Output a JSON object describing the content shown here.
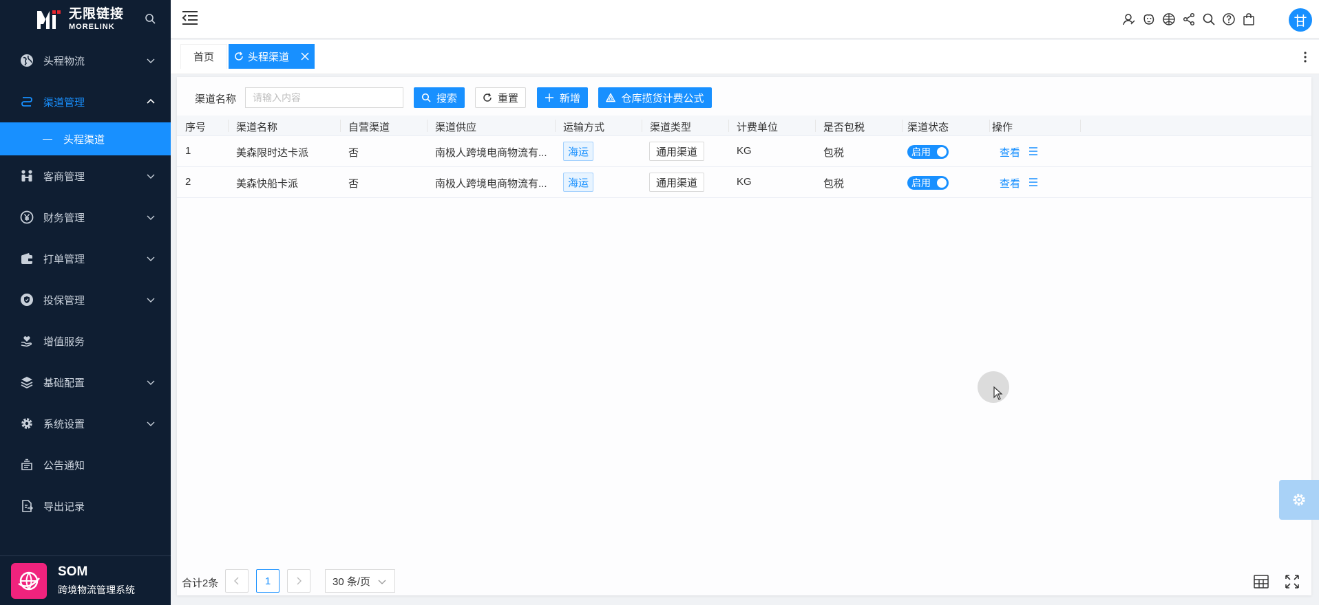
{
  "app": {
    "logo_cn": "无限链接",
    "logo_en": "MORELINK",
    "footer_title": "SOM",
    "footer_subtitle": "跨境物流管理系统"
  },
  "sidebar": {
    "items": [
      {
        "label": "头程物流",
        "icon": "globe-icon",
        "expandable": true
      },
      {
        "label": "渠道管理",
        "icon": "route-icon",
        "expandable": true,
        "expanded": true
      },
      {
        "label": "客商管理",
        "icon": "people-icon",
        "expandable": true
      },
      {
        "label": "财务管理",
        "icon": "yen-icon",
        "expandable": true
      },
      {
        "label": "打单管理",
        "icon": "wallet-icon",
        "expandable": true
      },
      {
        "label": "投保管理",
        "icon": "shield-icon",
        "expandable": true
      },
      {
        "label": "增值服务",
        "icon": "heart-hand-icon",
        "expandable": false
      },
      {
        "label": "基础配置",
        "icon": "layers-icon",
        "expandable": true
      },
      {
        "label": "系统设置",
        "icon": "gear-icon",
        "expandable": true
      },
      {
        "label": "公告通知",
        "icon": "announcement-icon",
        "expandable": false
      },
      {
        "label": "导出记录",
        "icon": "export-icon",
        "expandable": false
      }
    ],
    "submenu_active": "头程渠道"
  },
  "header": {
    "avatar_text": "甘",
    "tools": [
      "user-icon",
      "face-icon",
      "globe-grid-icon",
      "share-icon",
      "search-icon",
      "help-icon",
      "bag-icon"
    ]
  },
  "tabs": {
    "home": "首页",
    "active": "头程渠道"
  },
  "filter": {
    "label": "渠道名称",
    "placeholder": "请输入内容",
    "search_btn": "搜索",
    "reset_btn": "重置",
    "add_btn": "新增",
    "formula_btn": "仓库揽货计费公式"
  },
  "table": {
    "columns": [
      "序号",
      "渠道名称",
      "自营渠道",
      "渠道供应",
      "运输方式",
      "渠道类型",
      "计费单位",
      "是否包税",
      "渠道状态",
      "操作"
    ],
    "rows": [
      {
        "no": "1",
        "name": "美森限时达卡派",
        "self": "否",
        "supplier": "南极人跨境电商物流有...",
        "transport": "海运",
        "type": "通用渠道",
        "unit": "KG",
        "tax": "包税",
        "status": "启用",
        "action": "查看"
      },
      {
        "no": "2",
        "name": "美森快船卡派",
        "self": "否",
        "supplier": "南极人跨境电商物流有...",
        "transport": "海运",
        "type": "通用渠道",
        "unit": "KG",
        "tax": "包税",
        "status": "启用",
        "action": "查看"
      }
    ]
  },
  "pagination": {
    "total": "合计2条",
    "current_page": "1",
    "page_size": "30 条/页"
  },
  "colors": {
    "primary": "#1890ff",
    "sidebar_bg": "#0f1e32",
    "footer_logo": "#f0237d"
  }
}
